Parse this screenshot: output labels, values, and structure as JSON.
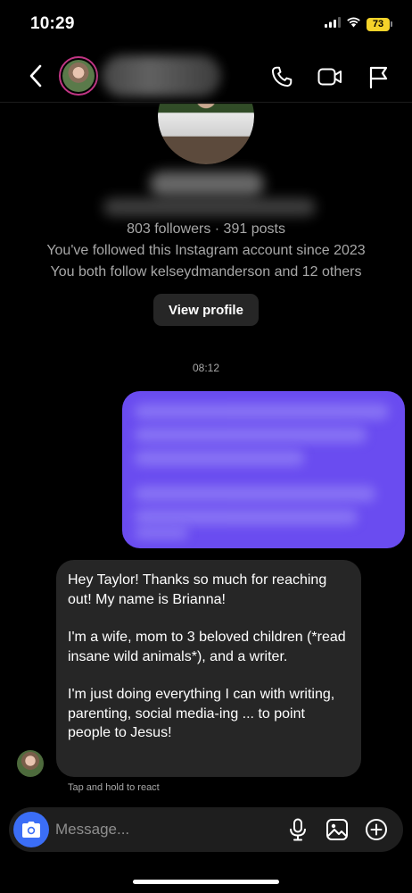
{
  "status_bar": {
    "time": "10:29",
    "battery": "73",
    "icons": [
      "signal-icon",
      "wifi-icon",
      "battery-icon"
    ],
    "battery_color": "#f5d32a"
  },
  "header": {
    "icons": [
      "chevron-left-icon",
      "phone-icon",
      "video-icon",
      "flag-icon"
    ],
    "ring_color": "#c13584"
  },
  "profile": {
    "stats": "803 followers · 391 posts",
    "followed_since": "You've followed this Instagram account since 2023",
    "mutual": "You both follow kelseydmanderson and 12 others",
    "view_profile_label": "View profile"
  },
  "thread": {
    "timestamp": "08:12",
    "sent_bubble_color": "#6a4cf0",
    "received_message": {
      "paragraphs": [
        "Hey Taylor! Thanks so much for reaching out! My name is Brianna!",
        "I'm a wife, mom to 3 beloved children (*read insane wild animals*), and a writer.",
        "I'm just doing everything I can with writing, parenting, social media-ing ... to point people to Jesus!"
      ]
    },
    "react_hint": "Tap and hold to react"
  },
  "composer": {
    "placeholder": "Message...",
    "icons": [
      "camera-icon",
      "microphone-icon",
      "image-icon",
      "plus-circle-icon"
    ],
    "camera_color": "#3b6ef6"
  }
}
